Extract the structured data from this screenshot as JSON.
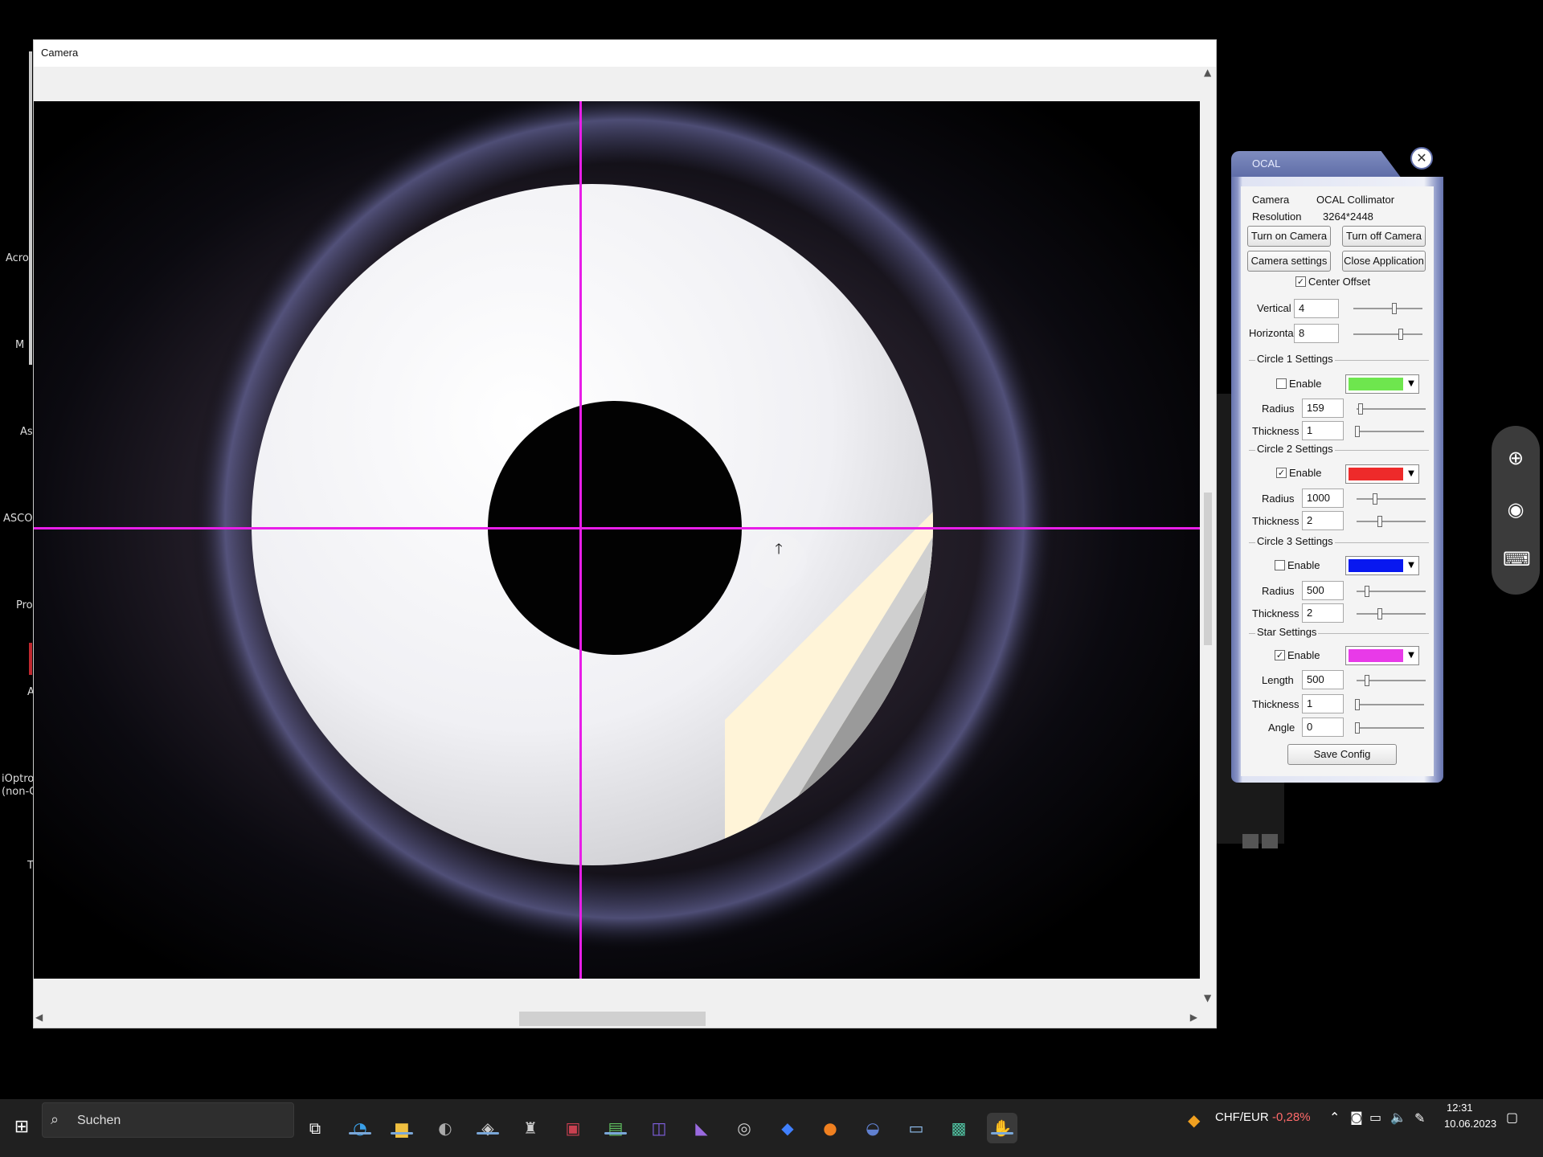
{
  "desktop": {
    "labels": [
      "Acro",
      "M",
      "As",
      "ASCO",
      "Pro",
      "A",
      "iOptro",
      "(non-C",
      "T"
    ]
  },
  "camera_window": {
    "title": "Camera"
  },
  "ocal": {
    "title": "OCAL",
    "camera_label": "Camera",
    "camera_value": "OCAL Collimator",
    "resolution_label": "Resolution",
    "resolution_value": "3264*2448",
    "turn_on_label": "Turn on Camera",
    "turn_off_label": "Turn off Camera",
    "camera_settings_label": "Camera settings",
    "close_app_label": "Close Application",
    "center_offset_label": "Center Offset",
    "center_offset_checked": "✓",
    "vertical_label": "Vertical",
    "vertical_value": "4",
    "horizontal_label": "Horizontal",
    "horizontal_value": "8",
    "circle1": {
      "title": "Circle 1 Settings",
      "enable_label": "Enable",
      "enable_mark": "",
      "color": "#6ee64e",
      "radius_label": "Radius",
      "radius_value": "159",
      "thickness_label": "Thickness",
      "thickness_value": "1"
    },
    "circle2": {
      "title": "Circle 2 Settings",
      "enable_label": "Enable",
      "enable_mark": "✓",
      "color": "#ee2a2a",
      "radius_label": "Radius",
      "radius_value": "1000",
      "thickness_label": "Thickness",
      "thickness_value": "2"
    },
    "circle3": {
      "title": "Circle 3 Settings",
      "enable_label": "Enable",
      "enable_mark": "",
      "color": "#0818f0",
      "radius_label": "Radius",
      "radius_value": "500",
      "thickness_label": "Thickness",
      "thickness_value": "2"
    },
    "star": {
      "title": "Star Settings",
      "enable_label": "Enable",
      "enable_mark": "✓",
      "color": "#e83ae8",
      "length_label": "Length",
      "length_value": "500",
      "thickness_label": "Thickness",
      "thickness_value": "1",
      "angle_label": "Angle",
      "angle_value": "0"
    },
    "save_label": "Save Config"
  },
  "crosshair_color": "#e81ee8",
  "taskbar": {
    "search_placeholder": "Suchen",
    "ticker_label": "CHF/EUR",
    "ticker_value": "-0,28%",
    "time": "12:31",
    "date": "10.06.2023"
  }
}
